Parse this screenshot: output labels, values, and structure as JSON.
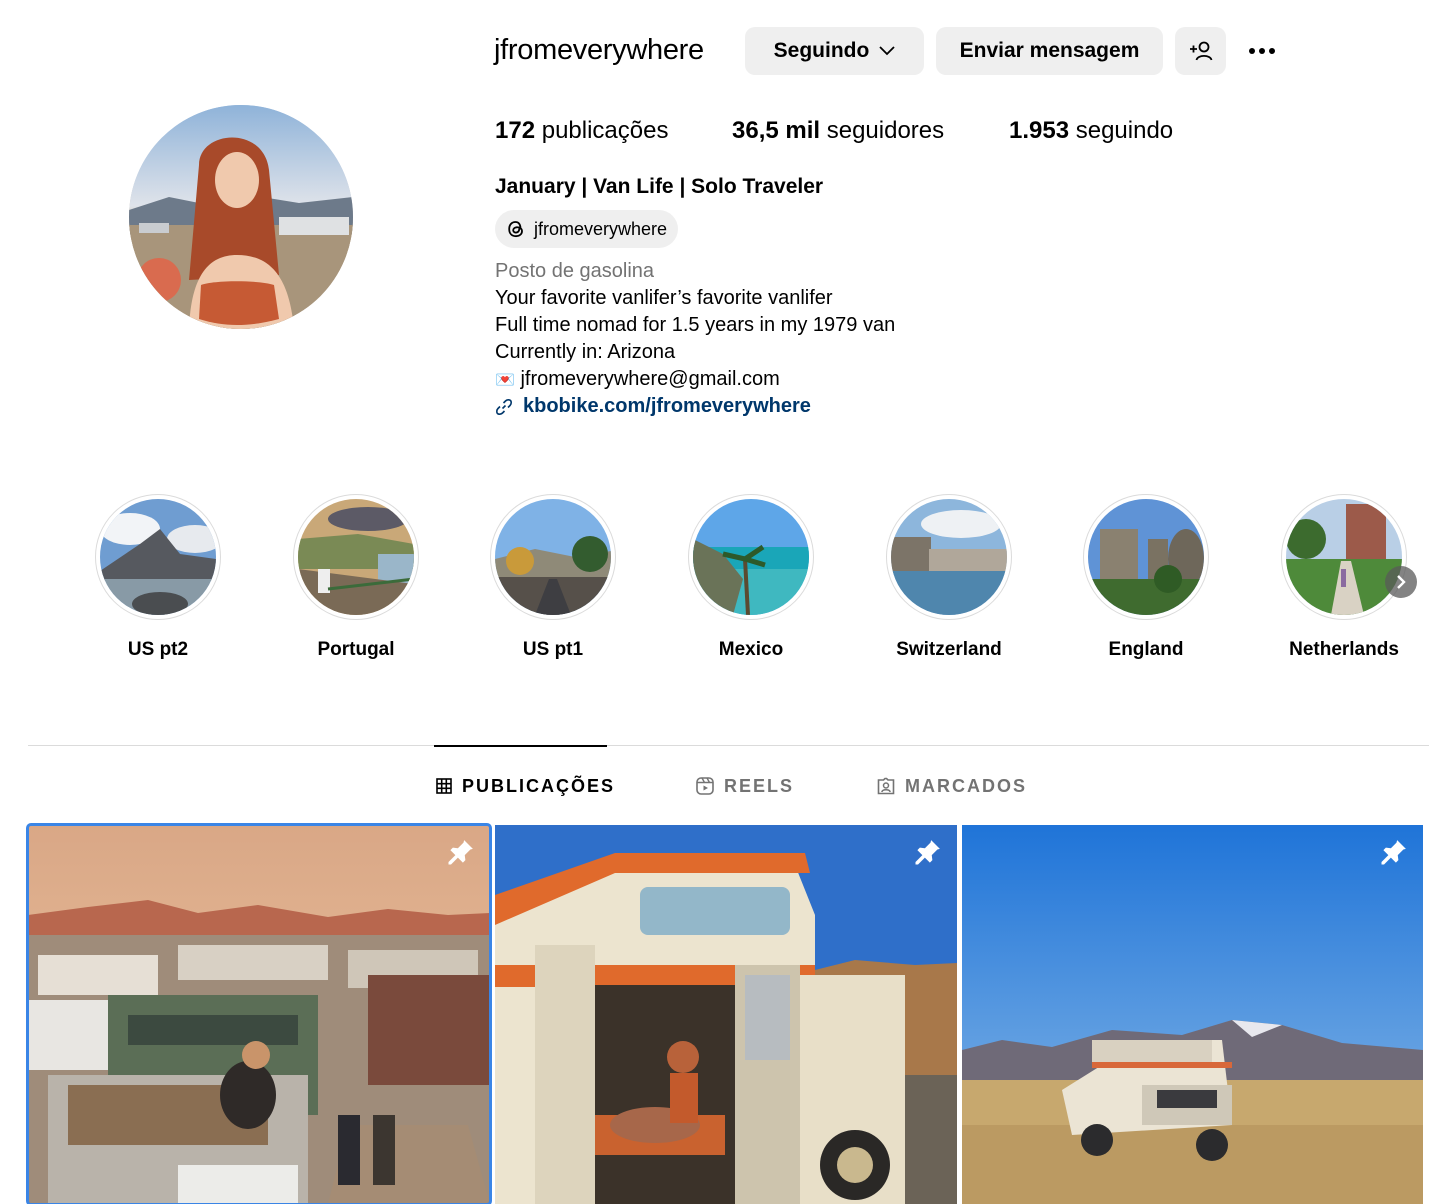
{
  "profile": {
    "username": "jfromeverywhere",
    "follow_button_label": "Seguindo",
    "message_button_label": "Enviar mensagem"
  },
  "stats": {
    "posts_count": "172",
    "posts_label": "publicações",
    "followers_count": "36,5 mil",
    "followers_label": "seguidores",
    "following_count": "1.953",
    "following_label": "seguindo"
  },
  "bio": {
    "full_name": "January | Van Life | Solo Traveler",
    "threads_handle": "jfromeverywhere",
    "category": "Posto de gasolina",
    "line1": "Your favorite vanlifer’s favorite vanlifer",
    "line2": "Full time nomad for 1.5 years in my 1979 van",
    "line3": "Currently in: Arizona",
    "email_emoji": "💌",
    "email": "jfromeverywhere@gmail.com",
    "link": "kbobike.com/jfromeverywhere"
  },
  "highlights": [
    {
      "label": "US pt2"
    },
    {
      "label": "Portugal"
    },
    {
      "label": "US pt1"
    },
    {
      "label": "Mexico"
    },
    {
      "label": "Switzerland"
    },
    {
      "label": "England"
    },
    {
      "label": "Netherlands"
    }
  ],
  "tabs": [
    {
      "label": "PUBLICAÇÕES",
      "active": true
    },
    {
      "label": "REELS",
      "active": false
    },
    {
      "label": "MARCADOS",
      "active": false
    }
  ],
  "icons": {
    "follow_chevron": "chevron-down-icon",
    "add_person": "add-person-icon",
    "more": "more-options-icon",
    "threads": "threads-icon",
    "link": "link-icon",
    "posts_tab": "grid-icon",
    "reels_tab": "reels-icon",
    "tagged_tab": "tagged-icon",
    "pinned": "pin-icon",
    "next": "chevron-right-icon"
  },
  "colors": {
    "link": "#00376b",
    "button_bg": "#efefef",
    "secondary_text": "#737373",
    "selection_outline": "#3a85e6"
  }
}
